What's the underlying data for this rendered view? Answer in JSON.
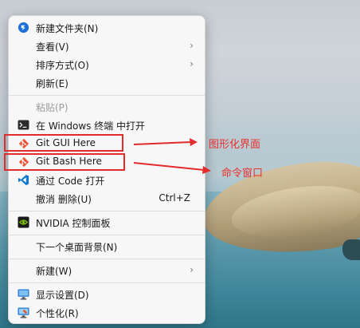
{
  "menu": {
    "items": [
      {
        "label": "新建文件夹(N)",
        "icon": "new-folder-icon"
      },
      {
        "label": "查看(V)",
        "submenu": true
      },
      {
        "label": "排序方式(O)",
        "submenu": true
      },
      {
        "label": "刷新(E)"
      },
      {
        "label": "粘贴(P)",
        "disabled": true
      },
      {
        "label": "在 Windows 终端 中打开",
        "icon": "terminal-icon"
      },
      {
        "label": "Git GUI Here",
        "icon": "git-icon"
      },
      {
        "label": "Git Bash Here",
        "icon": "git-icon"
      },
      {
        "label": "通过 Code 打开",
        "icon": "vscode-icon"
      },
      {
        "label": "撤消 删除(U)",
        "shortcut": "Ctrl+Z"
      },
      {
        "label": "NVIDIA 控制面板",
        "icon": "nvidia-icon"
      },
      {
        "label": "下一个桌面背景(N)"
      },
      {
        "label": "新建(W)",
        "submenu": true
      },
      {
        "label": "显示设置(D)",
        "icon": "display-settings-icon"
      },
      {
        "label": "个性化(R)",
        "icon": "personalize-icon"
      }
    ],
    "submenu_arrow": "›"
  },
  "annotations": {
    "gui": "图形化界面",
    "bash": "命令窗口"
  },
  "colors": {
    "annotation_red": "#e22b2b",
    "git_orange": "#f05033",
    "vscode_blue": "#0f7ad0",
    "nvidia_green": "#76b900"
  }
}
